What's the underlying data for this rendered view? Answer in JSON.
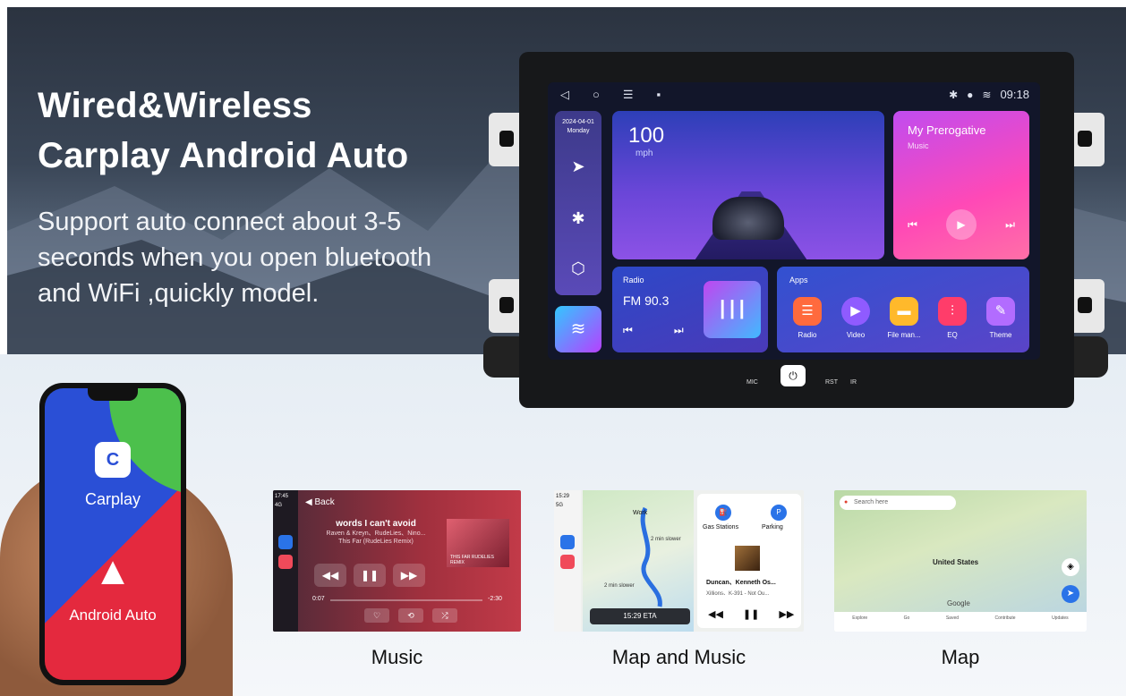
{
  "hero": {
    "title_line1": "Wired&Wireless",
    "title_line2": "Carplay Android Auto",
    "sub_line1": "Support auto connect about 3-5",
    "sub_line2": "seconds when you open bluetooth",
    "sub_line3": "and WiFi ,quickly model."
  },
  "unit": {
    "status": {
      "back_icon": "◁",
      "home_icon": "○",
      "menu_icon": "☰",
      "time": "09:18"
    },
    "side": {
      "date": "2024-04-01",
      "day": "Monday"
    },
    "speed": {
      "value": "100",
      "unit": "mph"
    },
    "music": {
      "title": "My Prerogative",
      "subtitle": "Music"
    },
    "radio": {
      "label": "Radio",
      "station": "FM 90.3"
    },
    "apps": {
      "label": "Apps",
      "items": [
        {
          "label": "Radio",
          "color": "#ff6a3d"
        },
        {
          "label": "Video",
          "color": "#8f5bff"
        },
        {
          "label": "File man...",
          "color": "#ffb92b"
        },
        {
          "label": "EQ",
          "color": "#ff3d6a"
        },
        {
          "label": "Theme",
          "color": "#b26cff"
        }
      ]
    },
    "bezel": {
      "mic": "MIC",
      "rst": "RST",
      "ir": "IR"
    }
  },
  "phone": {
    "carplay_label": "Carplay",
    "android_label": "Android Auto"
  },
  "thumbs": {
    "music": {
      "caption": "Music",
      "clock": "17:45",
      "signal": "4G",
      "back": "Back",
      "song": "words I can't avoid",
      "artists": "Raven & Kreyn、RudeLies、Nino...",
      "album": "This Far (RudeLies Remix)",
      "cover_text": "THIS FAR RUDELIES REMIX",
      "time_left": "0:07",
      "time_right": "-2:30"
    },
    "mapmusic": {
      "caption": "Map and Music",
      "clock": "15:29",
      "signal": "5G",
      "work": "Work",
      "min_a": "2 min slower",
      "min_b": "2 min slower",
      "eta": "15:29 ETA",
      "gas": "Gas Stations",
      "parking": "Parking",
      "song": "Duncan、Kenneth Os...",
      "artist": "Xillions、K-391 - Not Ou..."
    },
    "map": {
      "caption": "Map",
      "search": "Search here",
      "country": "United States",
      "google": "Google",
      "tabs": [
        "Explore",
        "Go",
        "Saved",
        "Contribute",
        "Updates"
      ]
    }
  }
}
